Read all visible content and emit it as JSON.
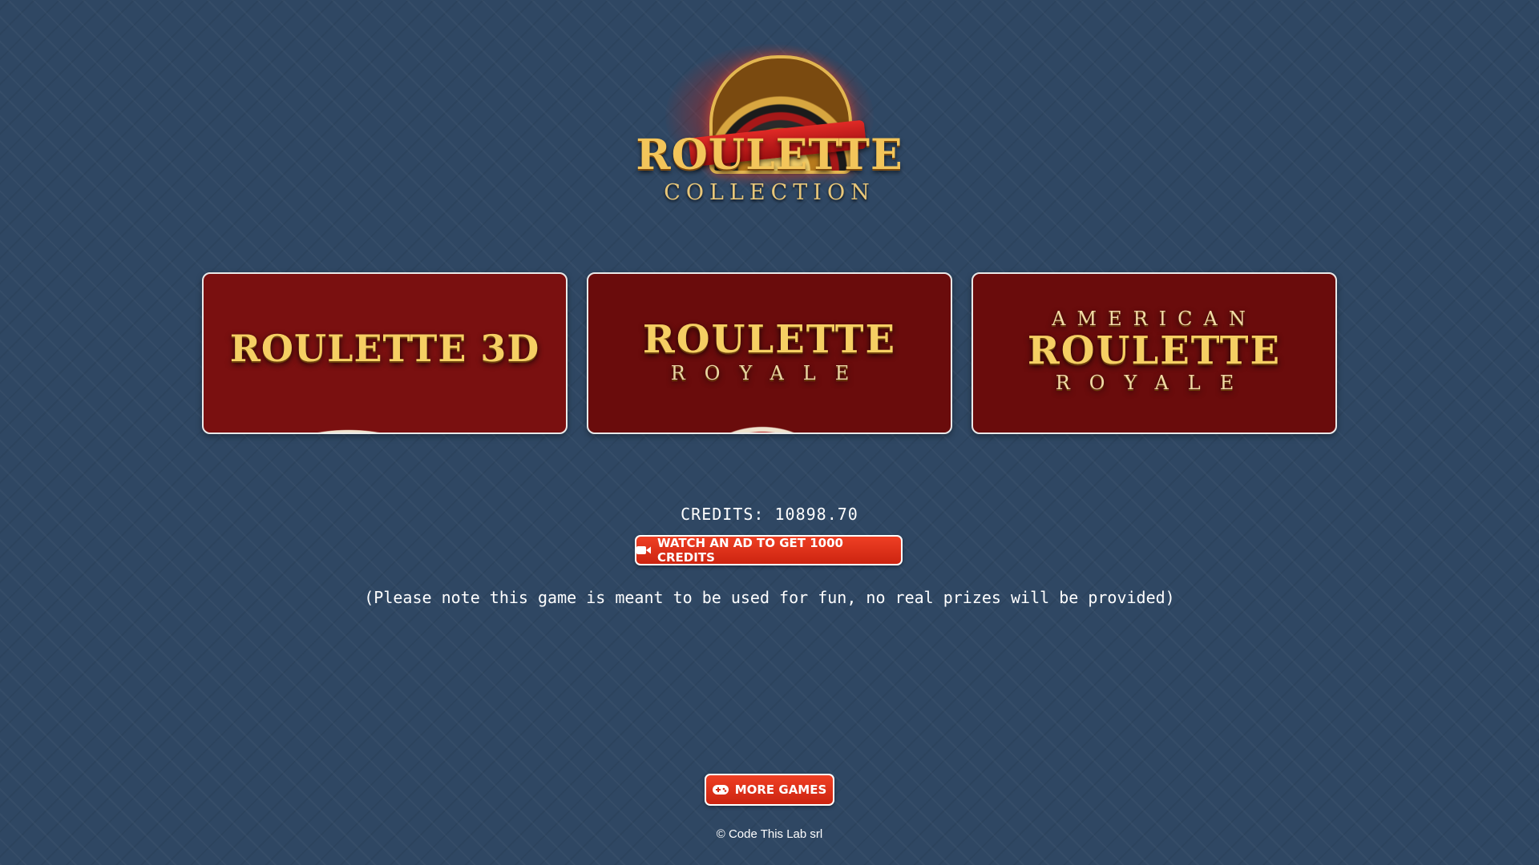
{
  "logo": {
    "title": "ROULETTE",
    "subtitle": "COLLECTION"
  },
  "games": [
    {
      "title": "ROULETTE 3D"
    },
    {
      "title": "ROULETTE",
      "subtitle": "ROYALE"
    },
    {
      "pretitle": "AMERICAN",
      "title": "ROULETTE",
      "subtitle": "ROYALE"
    }
  ],
  "credits": {
    "text": "CREDITS: 10898.70"
  },
  "ad_button": {
    "label": "WATCH AN AD TO GET 1000 CREDITS",
    "icon": "video-camera-icon"
  },
  "note": "(Please note this game is meant to be used for fun, no real prizes will be provided)",
  "more_games": {
    "label": "MORE GAMES",
    "icon": "gamepad-icon"
  },
  "copyright": "© Code This Lab srl",
  "colors": {
    "background": "#2f4763",
    "button": "#e0341a",
    "gold": "#f5cf63"
  }
}
